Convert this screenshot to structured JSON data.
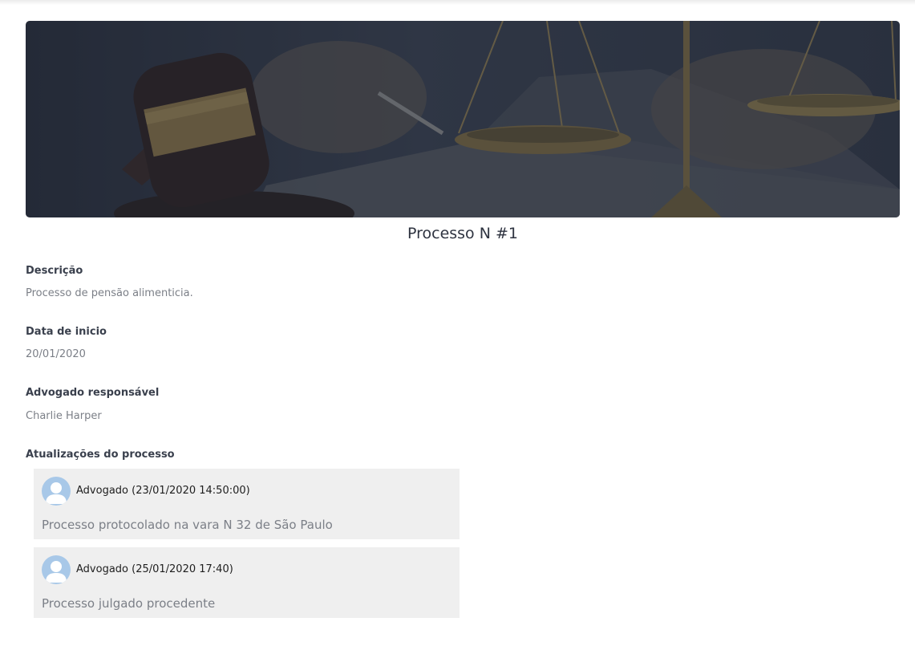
{
  "process": {
    "title": "Processo N #1",
    "fields": [
      {
        "label": "Descrição",
        "value": "Processo de pensão alimenticia."
      },
      {
        "label": "Data de inicio",
        "value": "20/01/2020"
      },
      {
        "label": "Advogado responsável",
        "value": "Charlie Harper"
      }
    ],
    "updates_label": "Atualizações do processo",
    "updates": [
      {
        "author": "Advogado (23/01/2020 14:50:00)",
        "text": "Processo protocolado na vara N 32 de São Paulo"
      },
      {
        "author": "Advogado (25/01/2020 17:40)",
        "text": "Processo julgado procedente"
      }
    ]
  },
  "banner": {
    "icon": "gavel-scales-image"
  },
  "colors": {
    "update_bg": "#efefef",
    "avatar": "#a8c8e8"
  }
}
